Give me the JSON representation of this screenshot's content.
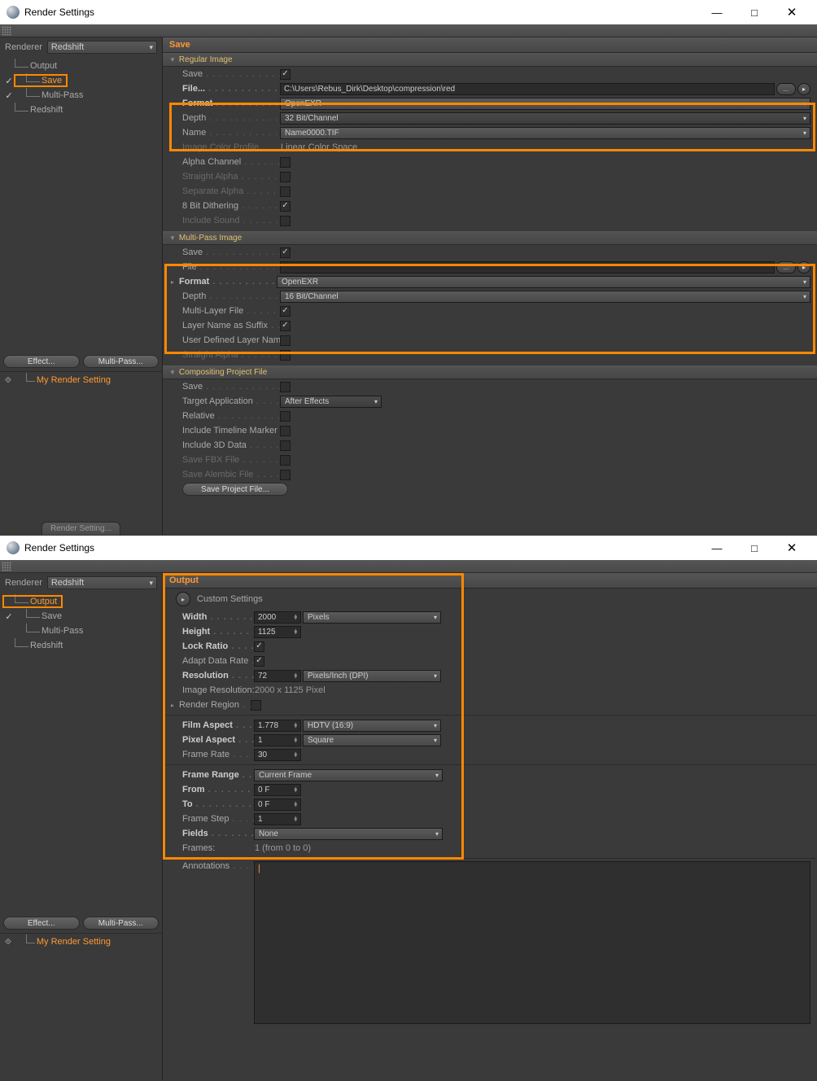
{
  "win1": {
    "title": "Render Settings",
    "renderer_label": "Renderer",
    "renderer_value": "Redshift",
    "tree": {
      "output": "Output",
      "save": "Save",
      "multipass": "Multi-Pass",
      "redshift": "Redshift"
    },
    "effect_btn": "Effect...",
    "multipass_btn": "Multi-Pass...",
    "my_render": "My Render Setting",
    "render_setting_tab": "Render Setting...",
    "content_title": "Save",
    "regular": {
      "header": "Regular Image",
      "save": "Save",
      "file": "File...",
      "file_value": "C:\\Users\\Rebus_Dirk\\Desktop\\compression\\red",
      "format": "Format",
      "format_value": "OpenEXR",
      "depth": "Depth",
      "depth_value": "32 Bit/Channel",
      "name": "Name",
      "name_value": "Name0000.TIF",
      "color_profile": "Image Color Profile",
      "color_profile_value": "Linear Color Space",
      "alpha": "Alpha Channel",
      "straight": "Straight Alpha",
      "separate": "Separate Alpha",
      "dither": "8 Bit Dithering",
      "sound": "Include Sound"
    },
    "multipass": {
      "header": "Multi-Pass Image",
      "save": "Save",
      "file": "File",
      "format": "Format",
      "format_value": "OpenEXR",
      "depth": "Depth",
      "depth_value": "16 Bit/Channel",
      "multilayer": "Multi-Layer File",
      "layersuffix": "Layer Name as Suffix",
      "userlayer": "User Defined Layer Name",
      "straight": "Straight Alpha"
    },
    "comp": {
      "header": "Compositing Project File",
      "save": "Save",
      "target": "Target Application",
      "target_value": "After Effects",
      "relative": "Relative",
      "timeline": "Include Timeline Marker",
      "include3d": "Include 3D Data",
      "fbx": "Save FBX File",
      "alembic": "Save Alembic File",
      "saveproject": "Save Project File..."
    }
  },
  "win2": {
    "title": "Render Settings",
    "renderer_label": "Renderer",
    "renderer_value": "Redshift",
    "tree": {
      "output": "Output",
      "save": "Save",
      "multipass": "Multi-Pass",
      "redshift": "Redshift"
    },
    "effect_btn": "Effect...",
    "multipass_btn": "Multi-Pass...",
    "my_render": "My Render Setting",
    "content_title": "Output",
    "custom": "Custom Settings",
    "output": {
      "width": "Width",
      "width_val": "2000",
      "width_unit": "Pixels",
      "height": "Height",
      "height_val": "1125",
      "lock": "Lock Ratio",
      "adapt": "Adapt Data Rate",
      "res": "Resolution",
      "res_val": "72",
      "res_unit": "Pixels/Inch (DPI)",
      "imgres_label": "Image Resolution:",
      "imgres_val": "2000 x 1125 Pixel",
      "region": "Render Region",
      "film": "Film Aspect",
      "film_val": "1.778",
      "film_unit": "HDTV (16:9)",
      "pixel": "Pixel Aspect",
      "pixel_val": "1",
      "pixel_unit": "Square",
      "fps": "Frame Rate",
      "fps_val": "30",
      "range": "Frame Range",
      "range_val": "Current Frame",
      "from": "From",
      "from_val": "0 F",
      "to": "To",
      "to_val": "0 F",
      "step": "Frame Step",
      "step_val": "1",
      "fields": "Fields",
      "fields_val": "None",
      "frames_label": "Frames:",
      "frames_val": "1 (from 0 to 0)",
      "annotations": "Annotations"
    }
  }
}
